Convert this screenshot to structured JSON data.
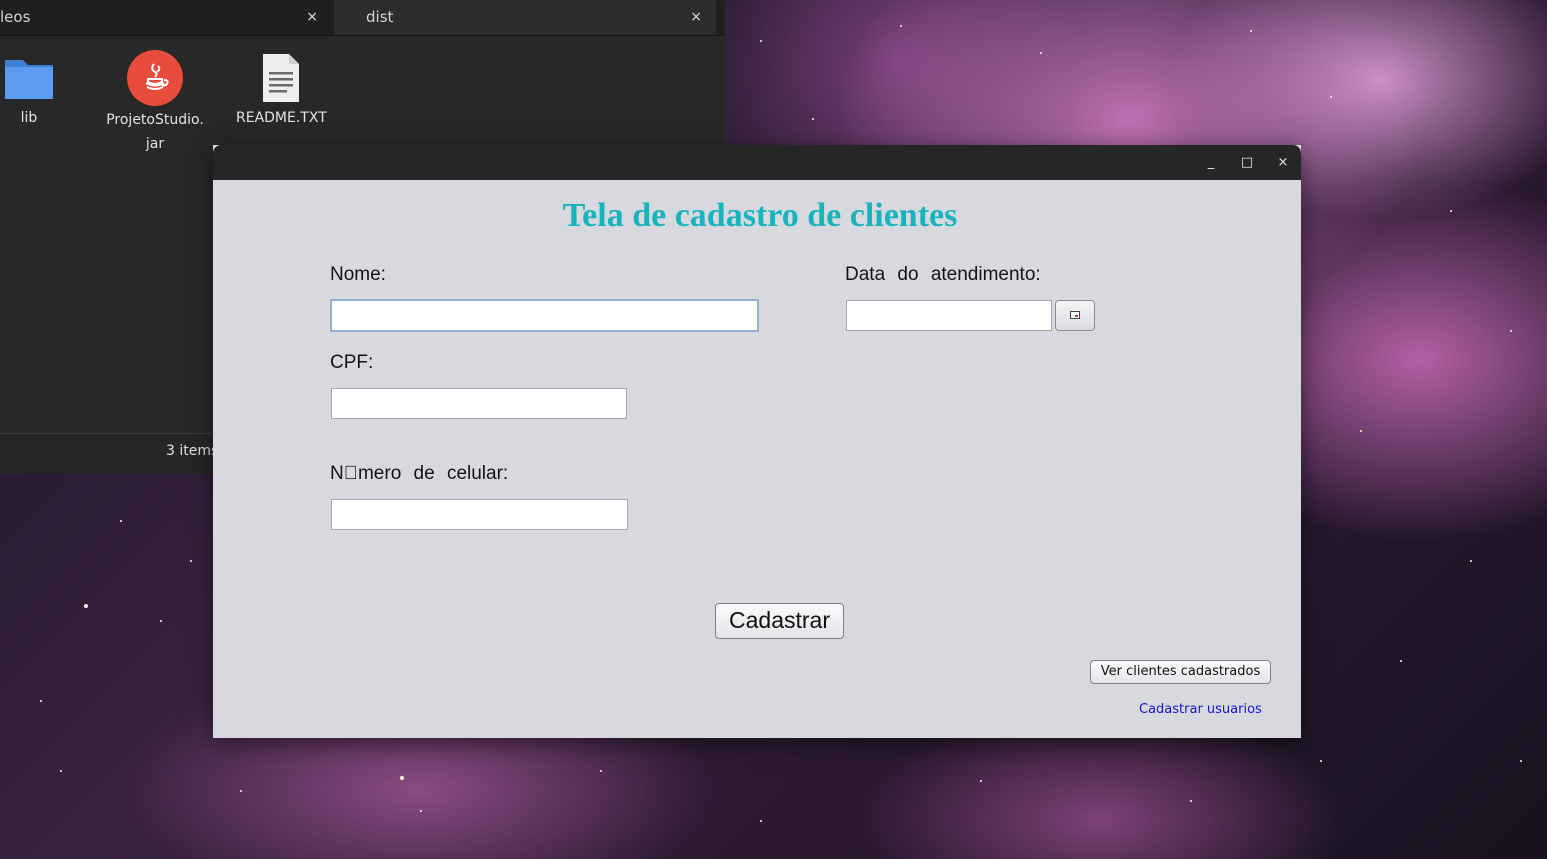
{
  "file_manager": {
    "tabs": [
      {
        "label": "leos",
        "close": "×"
      },
      {
        "label": "dist",
        "close": "×"
      }
    ],
    "items": [
      {
        "name": "lib",
        "icon": "folder-icon"
      },
      {
        "name_line1": "ProjetoStudio.",
        "name_line2": "jar",
        "icon": "java-icon"
      },
      {
        "name": "README.TXT",
        "icon": "text-file-icon"
      }
    ],
    "status": "3 items"
  },
  "app_window": {
    "controls": {
      "minimize": "_",
      "maximize": "□",
      "close": "×"
    },
    "title": "Tela de cadastro de clientes",
    "labels": {
      "nome": "Nome:",
      "data": "Data do atendimento:",
      "cpf": "CPF:",
      "celular": "N\u0000mero de celular:"
    },
    "values": {
      "nome": "",
      "data": "",
      "cpf": "",
      "celular": ""
    },
    "buttons": {
      "cadastrar": "Cadastrar",
      "ver_clientes": "Ver clientes cadastrados"
    },
    "link": "Cadastrar usuarios",
    "colors": {
      "title": "#18b4bd",
      "link": "#1414d6"
    }
  }
}
